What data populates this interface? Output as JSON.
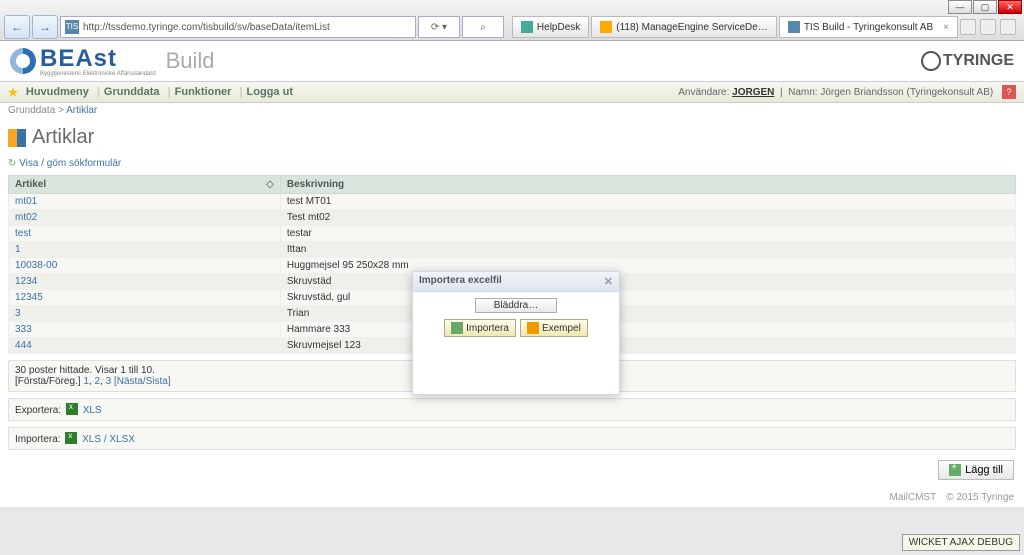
{
  "browser": {
    "url": "http://tssdemo.tyringe.com/tisbuild/sv/baseData/itemList",
    "search_suffix": "⌕",
    "tabs": [
      {
        "label": "HelpDesk"
      },
      {
        "label": "(118) ManageEngine ServiceDe…"
      },
      {
        "label": "TIS Build - Tyringekonsult AB"
      }
    ]
  },
  "logo": {
    "main": "BEAst",
    "sub": "Byggtjenestens Elektroniske Affärsstandard",
    "build": "Build"
  },
  "tyringe": "TYRINGE",
  "menu": {
    "huvudmeny": "Huvudmeny",
    "grunddata": "Grunddata",
    "funktioner": "Funktioner",
    "loggaut": "Logga ut"
  },
  "userbar": {
    "anvandare_lbl": "Användare:",
    "anvandare": "JORGEN",
    "namn_lbl": "Namn:",
    "namn": "Jörgen Briandsson (Tyringekonsult AB)"
  },
  "breadcrumb": {
    "root": "Grunddata",
    "sep": ">",
    "page": "Artiklar"
  },
  "title": "Artiklar",
  "toggle": "Visa / göm sökformulär",
  "cols": {
    "artikel": "Artikel",
    "beskrivning": "Beskrivning"
  },
  "rows": [
    {
      "a": "mt01",
      "b": "test MT01"
    },
    {
      "a": "mt02",
      "b": "Test mt02"
    },
    {
      "a": "test",
      "b": "testar"
    },
    {
      "a": "1",
      "b": "Ittan"
    },
    {
      "a": "10038-00",
      "b": "Huggmejsel 95 250x28 mm"
    },
    {
      "a": "1234",
      "b": "Skruvstäd"
    },
    {
      "a": "12345",
      "b": "Skruvstäd, gul"
    },
    {
      "a": "3",
      "b": "Trian"
    },
    {
      "a": "333",
      "b": "Hammare 333"
    },
    {
      "a": "444",
      "b": "Skruvmejsel 123"
    }
  ],
  "pager": {
    "summary": "30 poster hittade. Visar 1 till 10.",
    "first": "[Första/Föreg.]",
    "p1": "1",
    "p2": "2",
    "p3": "3",
    "next": "[Nästa/Sista]"
  },
  "export": {
    "label": "Exportera:",
    "xls": "XLS"
  },
  "import": {
    "label": "Importera:",
    "xls": "XLS / XLSX"
  },
  "addbtn": "Lägg till",
  "footer": {
    "left": "MailCMST",
    "right": "© 2015 Tyringe"
  },
  "debug": "WICKET AJAX DEBUG",
  "modal": {
    "title": "Importera excelfil",
    "browse": "Bläddra…",
    "import_btn": "Importera",
    "example_btn": "Exempel"
  }
}
